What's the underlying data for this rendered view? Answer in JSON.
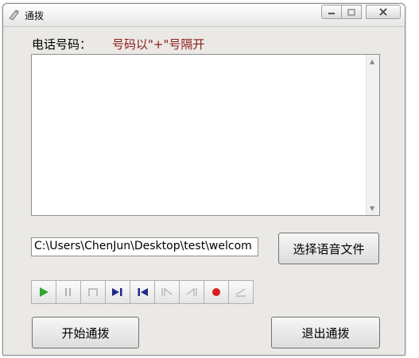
{
  "window": {
    "title": "通拨"
  },
  "form": {
    "phone_label": "电话号码：",
    "phone_hint": "号码以\"+\"号隔开",
    "phone_numbers": "",
    "file_path": "C:\\Users\\ChenJun\\Desktop\\test\\welcom",
    "select_button": "选择语音文件"
  },
  "media_controls": [
    {
      "name": "play-icon",
      "enabled": true,
      "color": "#2eaa2e"
    },
    {
      "name": "pause-icon",
      "enabled": false,
      "color": "#b0b0b0"
    },
    {
      "name": "stop-icon",
      "enabled": false,
      "color": "#b0b0b0"
    },
    {
      "name": "skip-forward-icon",
      "enabled": true,
      "color": "#1f2a8a"
    },
    {
      "name": "skip-back-icon",
      "enabled": true,
      "color": "#1f2a8a"
    },
    {
      "name": "step-forward-icon",
      "enabled": false,
      "color": "#b0b0b0"
    },
    {
      "name": "step-back-icon",
      "enabled": false,
      "color": "#b0b0b0"
    },
    {
      "name": "record-icon",
      "enabled": true,
      "color": "#d61f1f"
    },
    {
      "name": "eject-icon",
      "enabled": false,
      "color": "#b0b0b0"
    }
  ],
  "actions": {
    "start_label": "开始通拨",
    "exit_label": "退出通拨"
  }
}
